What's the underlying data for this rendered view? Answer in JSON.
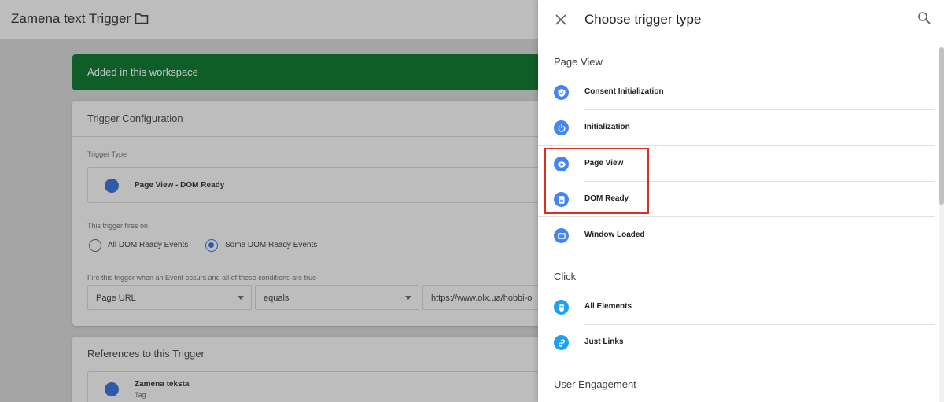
{
  "header": {
    "trigger_name": "Zamena text Trigger",
    "folder_icon": "folder-icon"
  },
  "banner": {
    "text": "Added in this workspace",
    "color": "#0f5e28"
  },
  "config": {
    "heading": "Trigger Configuration",
    "trigger_type_label": "Trigger Type",
    "trigger_type_value": "Page View - DOM Ready",
    "fires_on_label": "This trigger fires on",
    "radio_all": "All DOM Ready Events",
    "radio_some": "Some DOM Ready Events",
    "selected_radio": "Some DOM Ready Events",
    "condition_label": "Fire this trigger when an Event occurs and all of these conditions are true",
    "condition_variable": "Page URL",
    "condition_operator": "equals",
    "condition_value": "https://www.olx.ua/hobbi-o"
  },
  "references": {
    "heading": "References to this Trigger",
    "items": [
      {
        "name": "Zamena teksta",
        "type": "Tag"
      }
    ]
  },
  "panel": {
    "title": "Choose trigger type",
    "close_icon": "close-icon",
    "search_icon": "search-icon",
    "sections": [
      {
        "title": "Page View",
        "items": [
          {
            "label": "Consent Initialization",
            "icon": "shield-icon"
          },
          {
            "label": "Initialization",
            "icon": "power-icon"
          },
          {
            "label": "Page View",
            "icon": "eye-icon"
          },
          {
            "label": "DOM Ready",
            "icon": "document-icon"
          },
          {
            "label": "Window Loaded",
            "icon": "window-icon"
          }
        ]
      },
      {
        "title": "Click",
        "items": [
          {
            "label": "All Elements",
            "icon": "mouse-icon"
          },
          {
            "label": "Just Links",
            "icon": "link-icon"
          }
        ]
      },
      {
        "title": "User Engagement",
        "items": []
      }
    ]
  },
  "colors": {
    "accent": "#4285f4",
    "click_accent": "#1da1f2",
    "highlight": "#d93025"
  }
}
